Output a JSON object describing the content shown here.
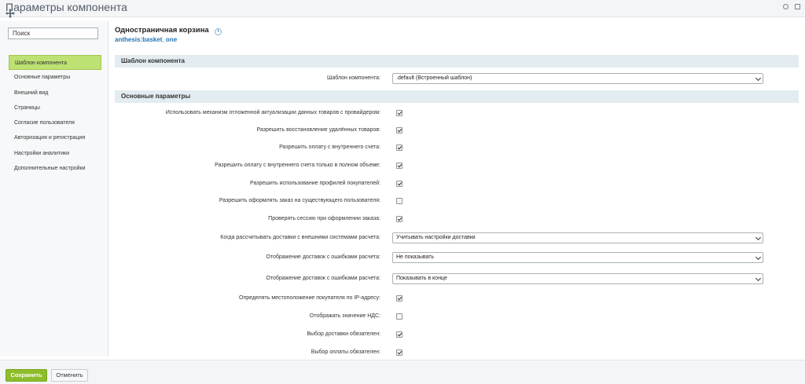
{
  "window": {
    "title": "Параметры компонента"
  },
  "sidebar": {
    "search_placeholder": "Поиск",
    "items": [
      {
        "label": "Шаблон компонента",
        "active": true
      },
      {
        "label": "Основные параметры"
      },
      {
        "label": "Внешний вид"
      },
      {
        "label": "Страницы"
      },
      {
        "label": "Согласие пользователя"
      },
      {
        "label": "Авторизация и регистрация"
      },
      {
        "label": "Настройки аналитики"
      },
      {
        "label": "Дополнительные настройки"
      }
    ]
  },
  "main": {
    "component_title": "Одностраничная корзина",
    "component_code": "anthesis:basket_one",
    "sections": [
      {
        "title": "Шаблон компонента"
      },
      {
        "title": "Основные параметры"
      }
    ],
    "template_row": {
      "label": "Шаблон компонента:",
      "value": ".default (Встроенный шаблон)"
    },
    "params": [
      {
        "label": "Использовать механизм отложенной актуализации данных товаров с провайдером:",
        "type": "checkbox",
        "checked": true
      },
      {
        "label": "Разрешить восстановление удалённых товаров:",
        "type": "checkbox",
        "checked": true
      },
      {
        "label": "Разрешить оплату с внутреннего счета:",
        "type": "checkbox",
        "checked": true
      },
      {
        "label": "Разрешить оплату с внутреннего счета только в полном объеме:",
        "type": "checkbox",
        "checked": true
      },
      {
        "label": "Разрешить использование профилей покупателей:",
        "type": "checkbox",
        "checked": true
      },
      {
        "label": "Разрешить оформлять заказ на существующего пользователя:",
        "type": "checkbox",
        "checked": false
      },
      {
        "label": "Проверять сессию при оформлении заказа:",
        "type": "checkbox",
        "checked": true
      },
      {
        "label": "Когда рассчитывать доставки с внешними системами расчета:",
        "type": "select",
        "value": "Учитывать настройки доставки"
      },
      {
        "label": "Отображение доставок с ошибками расчета:",
        "type": "select",
        "value": "Не показывать"
      },
      {
        "label": "Отображение доставок с ошибками расчета:",
        "type": "select",
        "value": "Показывать в конце"
      },
      {
        "label": "Определять местоположение покупателя по IP-адресу:",
        "type": "checkbox",
        "checked": true
      },
      {
        "label": "Отображать значение НДС:",
        "type": "checkbox",
        "checked": false
      },
      {
        "label": "Выбор доставки обязателен:",
        "type": "checkbox",
        "checked": true
      },
      {
        "label": "Выбор оплаты обязателен:",
        "type": "checkbox",
        "checked": true
      }
    ]
  },
  "footer": {
    "save_label": "Сохранить",
    "cancel_label": "Отменить"
  },
  "colors": {
    "accent": "#8ebd2b",
    "active_nav": "#bde172",
    "section_bg": "#e3ecf0",
    "link": "#2474b5"
  }
}
